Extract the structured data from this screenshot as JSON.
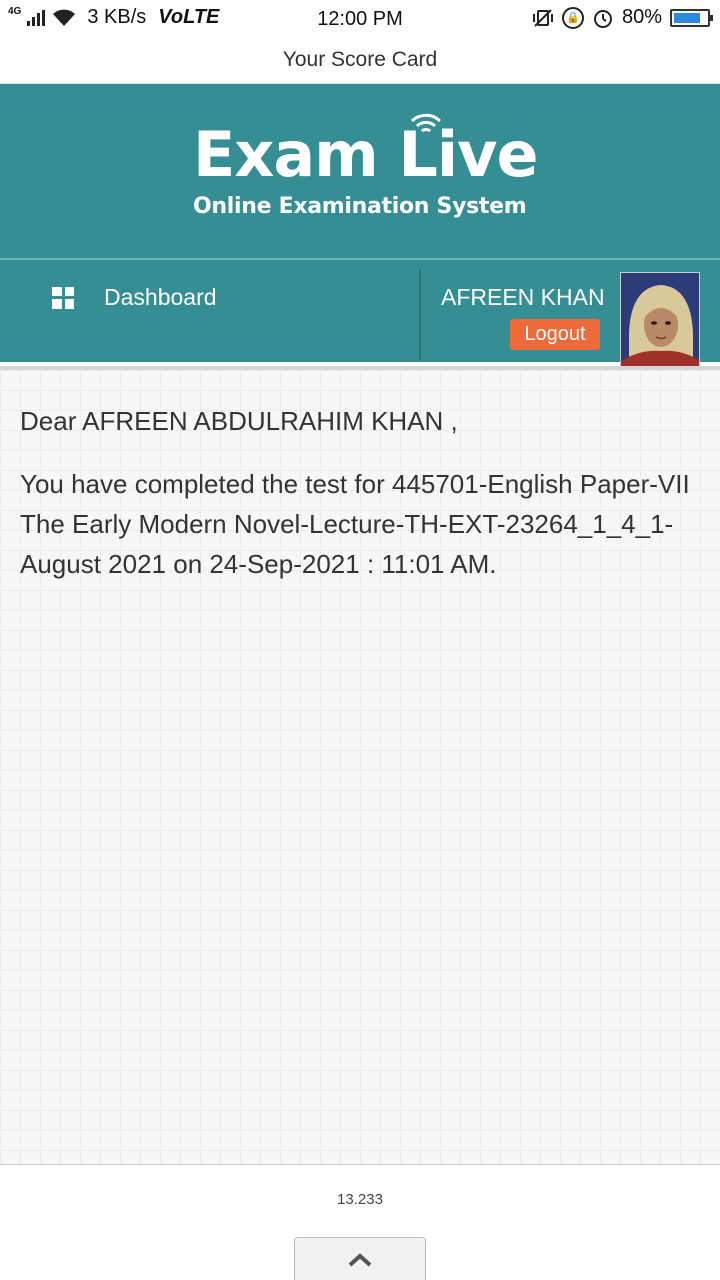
{
  "status_bar": {
    "network": "4G",
    "speed": "3 KB/s",
    "volte": "VoLTE",
    "time": "12:00 PM",
    "battery": "80%",
    "battery_level": 0.8
  },
  "title_bar": {
    "title": "Your Score Card"
  },
  "brand": {
    "logo_main": "Exam Live",
    "logo_sub": "Online Examination System",
    "color": "#358e93"
  },
  "nav": {
    "dashboard_label": "Dashboard",
    "user_name": "AFREEN KHAN",
    "logout_label": "Logout",
    "logout_color": "#ef6a3a"
  },
  "content": {
    "greeting": "Dear AFREEN ABDULRAHIM KHAN ,",
    "message": "You have completed the test for 445701-English Paper-VII The Early Modern Novel-Lecture-TH-EXT-23264_1_4_1-August 2021 on 24-Sep-2021 : 11:01 AM."
  },
  "footer": {
    "version": "13.233"
  }
}
